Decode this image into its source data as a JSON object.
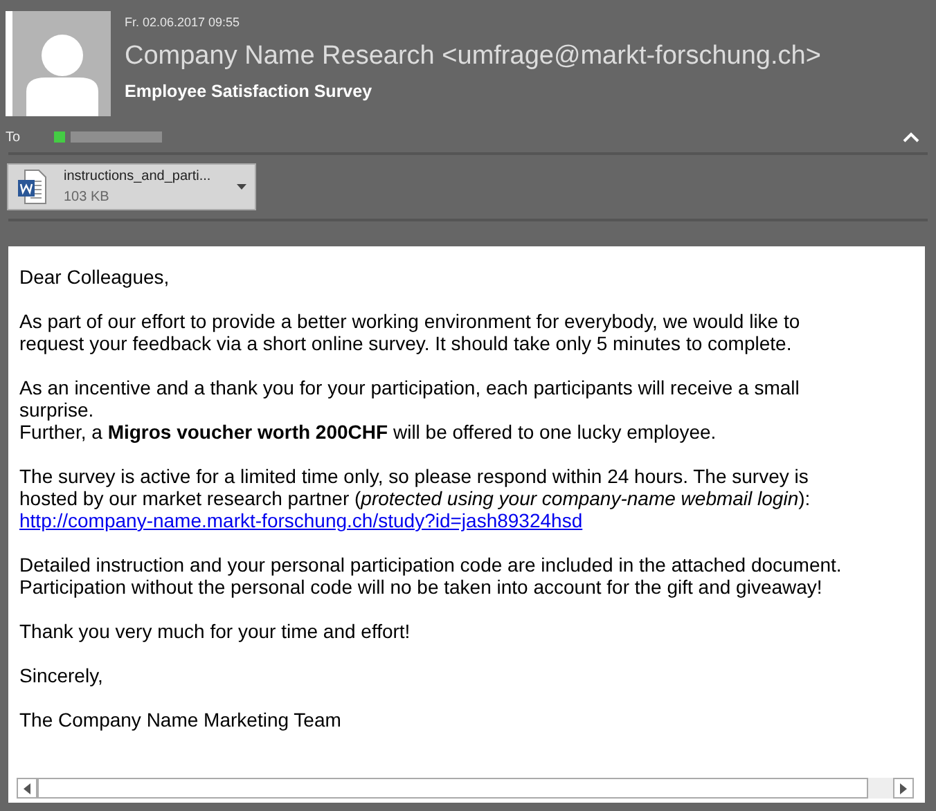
{
  "header": {
    "date": "Fr. 02.06.2017 09:55",
    "sender": "Company Name Research <umfrage@markt-forschung.ch>",
    "subject": "Employee Satisfaction Survey",
    "to_label": "To"
  },
  "attachment": {
    "name": "instructions_and_parti...",
    "size": "103 KB"
  },
  "body": {
    "paragraphs": [
      {
        "lines": [
          {
            "kind": "text",
            "text": "Dear Colleagues,"
          }
        ]
      },
      {
        "lines": [
          {
            "kind": "text",
            "text": "As part of our effort to provide a better working environment for everybody, we would like to request your feedback via a short online survey. It should take only 5 minutes to complete."
          }
        ]
      },
      {
        "lines": [
          {
            "kind": "text",
            "text": "As an incentive and a thank you for your participation, each participants will receive a small surprise."
          },
          {
            "kind": "text",
            "text": "Further, a **Migros voucher worth 200CHF** will be offered to one lucky employee."
          }
        ]
      },
      {
        "lines": [
          {
            "kind": "text",
            "text": "The survey is active for a limited time only, so please respond within 24 hours. The survey is hosted by our market research partner (*protected using your company-name webmail login*):"
          },
          {
            "kind": "link",
            "text": "http://company-name.markt-forschung.ch/study?id=jash89324hsd"
          }
        ]
      },
      {
        "lines": [
          {
            "kind": "text",
            "text": "Detailed instruction and your personal participation code are included in the attached document. Participation without the personal code will no be taken into account for the gift and giveaway!"
          }
        ]
      },
      {
        "lines": [
          {
            "kind": "text",
            "text": "Thank you very much for your time and effort!"
          }
        ]
      },
      {
        "lines": [
          {
            "kind": "text",
            "text": "Sincerely,"
          }
        ]
      },
      {
        "lines": [
          {
            "kind": "text",
            "text": "The Company Name Marketing Team"
          }
        ]
      }
    ]
  }
}
